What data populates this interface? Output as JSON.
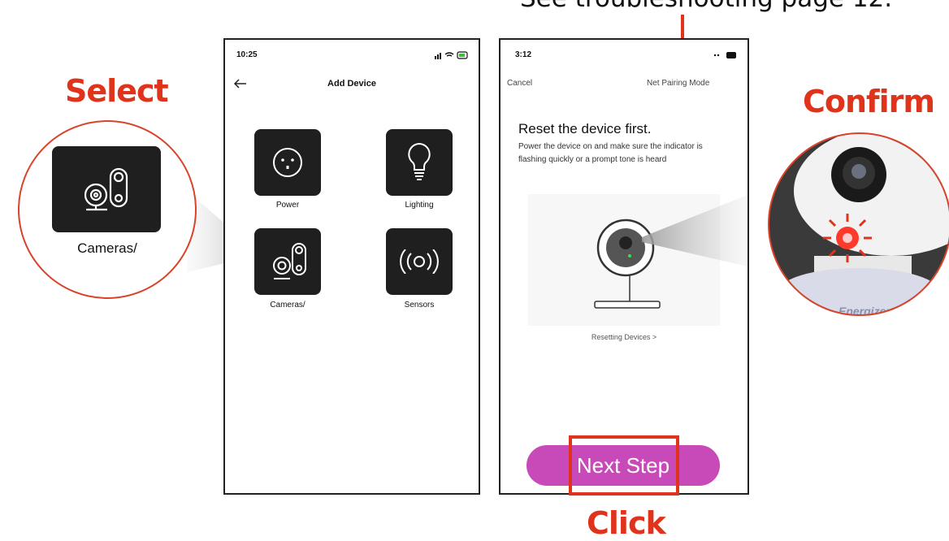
{
  "annotations": {
    "top_note": "See troubleshooting page 12.",
    "select": "Select",
    "confirm": "Confirm",
    "click": "Click"
  },
  "zoom_left": {
    "label": "Cameras/"
  },
  "phone_left": {
    "time": "10:25",
    "title": "Add Device",
    "back_icon": "arrow-left-icon",
    "tiles": [
      {
        "label": "Power",
        "icon": "outlet-icon"
      },
      {
        "label": "Lighting",
        "icon": "bulb-icon"
      },
      {
        "label": "Cameras/",
        "icon": "camera-icon"
      },
      {
        "label": "Sensors",
        "icon": "signal-icon"
      }
    ]
  },
  "phone_right": {
    "time": "3:12",
    "cancel": "Cancel",
    "mode": "Net Pairing Mode",
    "heading": "Reset the device first.",
    "body": "Power the device on and make sure the indicator is flashing quickly or a prompt tone is heard",
    "reset_link": "Resetting Devices >",
    "next_button": "Next Step"
  },
  "zoom_right": {
    "brand": "Energizer"
  },
  "colors": {
    "accent_red": "#e0331c",
    "button_magenta": "#c84ab8",
    "tile_dark": "#1f1f1f"
  }
}
